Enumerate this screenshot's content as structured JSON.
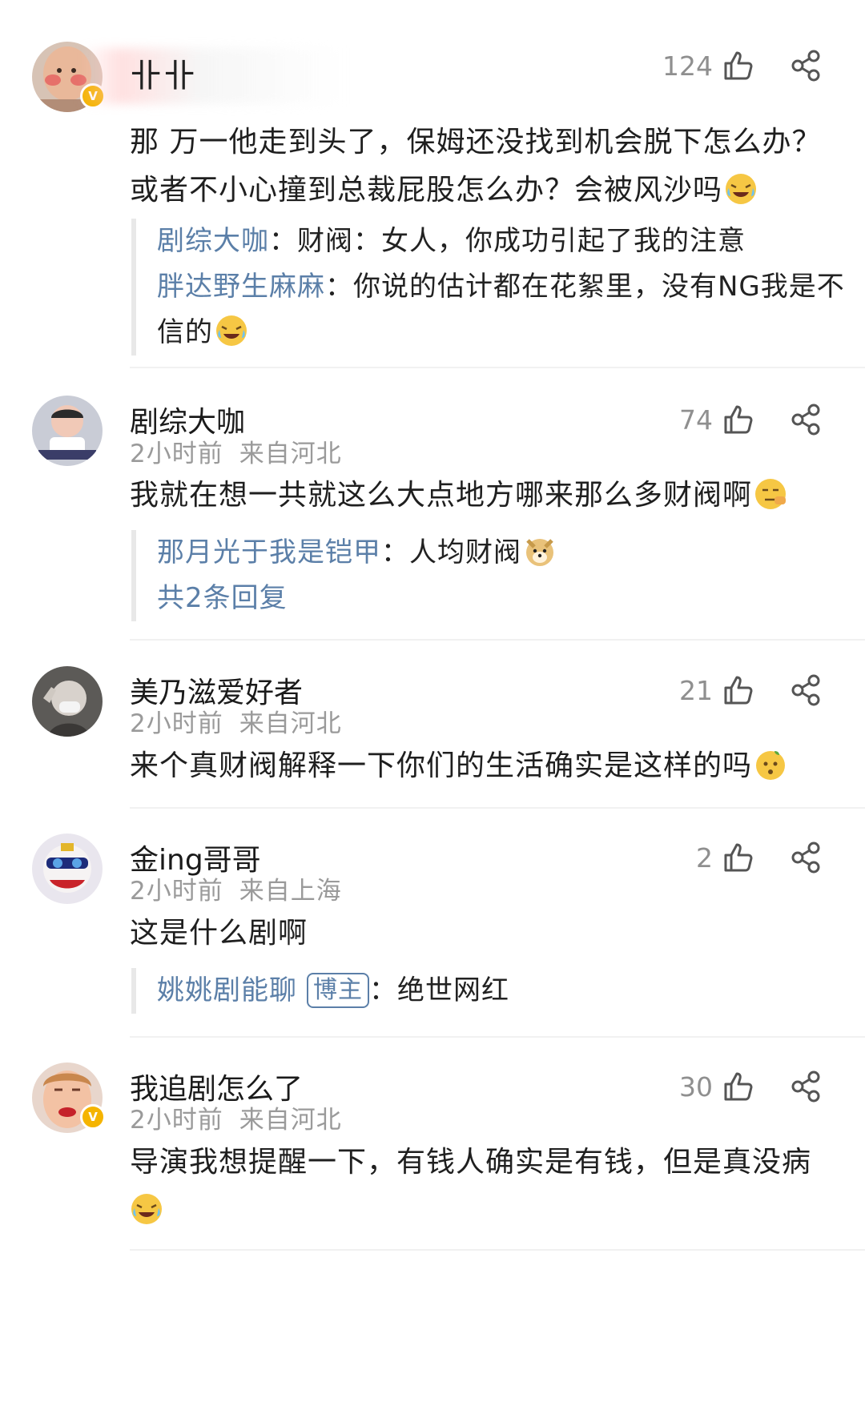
{
  "comments": [
    {
      "username": "卝卝",
      "likes": "124",
      "body": "那 万一他走到头了，保姆还没找到机会脱下怎么办？或者不小心撞到总裁屁股怎么办？会被风沙吗",
      "replies": [
        {
          "name": "剧综大咖",
          "text": "：财阀：女人，你成功引起了我的注意"
        },
        {
          "name": "胖达野生麻麻",
          "text": "：你说的估计都在花絮里，没有NG我是不信的"
        }
      ]
    },
    {
      "username": "剧综大咖",
      "time": "2小时前",
      "location": "来自河北",
      "likes": "74",
      "body": "我就在想一共就这么大点地方哪来那么多财阀啊",
      "replies": [
        {
          "name": "那月光于我是铠甲",
          "text": "：人均财阀"
        }
      ],
      "more_replies": "共2条回复"
    },
    {
      "username": "美乃滋爱好者",
      "time": "2小时前",
      "location": "来自河北",
      "likes": "21",
      "body": "来个真财阀解释一下你们的生活确实是这样的吗"
    },
    {
      "username": "金ing哥哥",
      "time": "2小时前",
      "location": "来自上海",
      "likes": "2",
      "body": "这是什么剧啊",
      "replies": [
        {
          "name": "姚姚剧能聊",
          "badge": "博主",
          "text": "：绝世网红"
        }
      ]
    },
    {
      "username": "我追剧怎么了",
      "time": "2小时前",
      "location": "来自河北",
      "likes": "30",
      "body": "导演我想提醒一下，有钱人确实是有钱，但是真没病"
    }
  ],
  "icons": {
    "like": "thumbs-up-outline-icon",
    "share": "share-icon",
    "verified": "verified-v-badge-icon"
  },
  "colors": {
    "link_blue": "#5b7fa8",
    "meta_gray": "#9a9a9a",
    "verified_gold": "#f5b400"
  }
}
